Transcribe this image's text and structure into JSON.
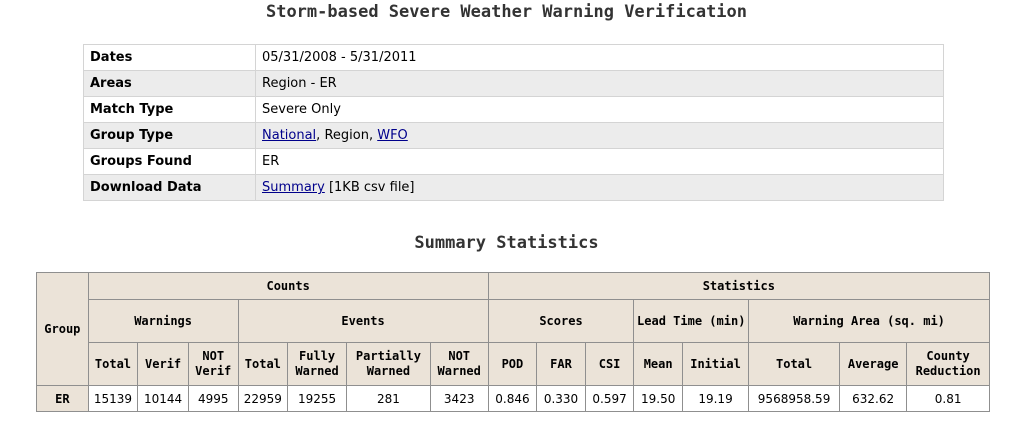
{
  "page": {
    "title": "Storm-based Severe Weather Warning Verification",
    "summary_title": "Summary Statistics"
  },
  "info": {
    "dates_label": "Dates",
    "dates_value": "05/31/2008 - 5/31/2011",
    "areas_label": "Areas",
    "areas_value": "Region - ER",
    "match_label": "Match Type",
    "match_value": "Severe Only",
    "group_type_label": "Group Type",
    "group_type_national": "National",
    "group_type_sep1": ", ",
    "group_type_region": "Region",
    "group_type_sep2": ", ",
    "group_type_wfo": "WFO",
    "groups_found_label": "Groups Found",
    "groups_found_value": "ER",
    "download_label": "Download Data",
    "download_link": "Summary",
    "download_note": " [1KB csv file]"
  },
  "stats": {
    "headers": {
      "group": "Group",
      "counts": "Counts",
      "statistics": "Statistics",
      "warnings": "Warnings",
      "events": "Events",
      "scores": "Scores",
      "lead_time": "Lead Time (min)",
      "warning_area": "Warning Area (sq. mi)",
      "w_total": "Total",
      "w_verif": "Verif",
      "w_not_verif": "NOT Verif",
      "e_total": "Total",
      "e_fully": "Fully Warned",
      "e_partially": "Partially Warned",
      "e_not": "NOT Warned",
      "pod": "POD",
      "far": "FAR",
      "csi": "CSI",
      "mean": "Mean",
      "initial": "Initial",
      "a_total": "Total",
      "a_average": "Average",
      "a_county": "County Reduction"
    },
    "row": {
      "group": "ER",
      "w_total": "15139",
      "w_verif": "10144",
      "w_not_verif": "4995",
      "e_total": "22959",
      "e_fully": "19255",
      "e_partially": "281",
      "e_not": "3423",
      "pod": "0.846",
      "far": "0.330",
      "csi": "0.597",
      "mean": "19.50",
      "initial": "19.19",
      "a_total": "9568958.59",
      "a_average": "632.62",
      "a_county": "0.81"
    }
  }
}
